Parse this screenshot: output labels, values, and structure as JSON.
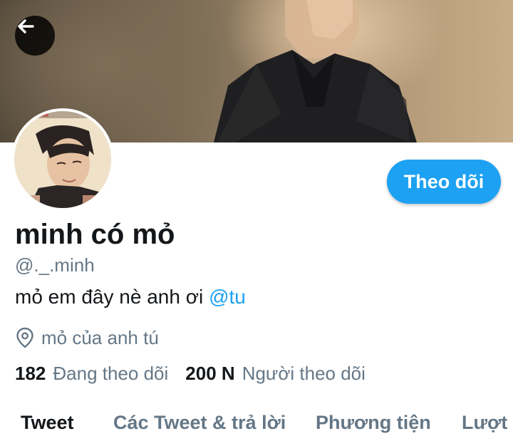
{
  "profile": {
    "display_name": "minh có mỏ",
    "handle": "@._.minh",
    "bio_text": "mỏ em đây nè anh ơi ",
    "bio_mention": "@tu",
    "location": "mỏ của anh tú"
  },
  "actions": {
    "follow_label": "Theo dõi"
  },
  "stats": {
    "following_count": "182",
    "following_label": "Đang theo dõi",
    "followers_count": "200 N",
    "followers_label": "Người theo dõi"
  },
  "tabs": [
    {
      "label": "Tweet",
      "active": true
    },
    {
      "label": "Các Tweet & trả lời",
      "active": false
    },
    {
      "label": "Phương tiện",
      "active": false
    },
    {
      "label": "Lượt thích",
      "active": false
    }
  ],
  "icons": {
    "back": "arrow-left-icon",
    "location": "map-pin-icon"
  },
  "colors": {
    "accent": "#1da1f2",
    "primary_text": "#14171a",
    "secondary_text": "#657786"
  }
}
